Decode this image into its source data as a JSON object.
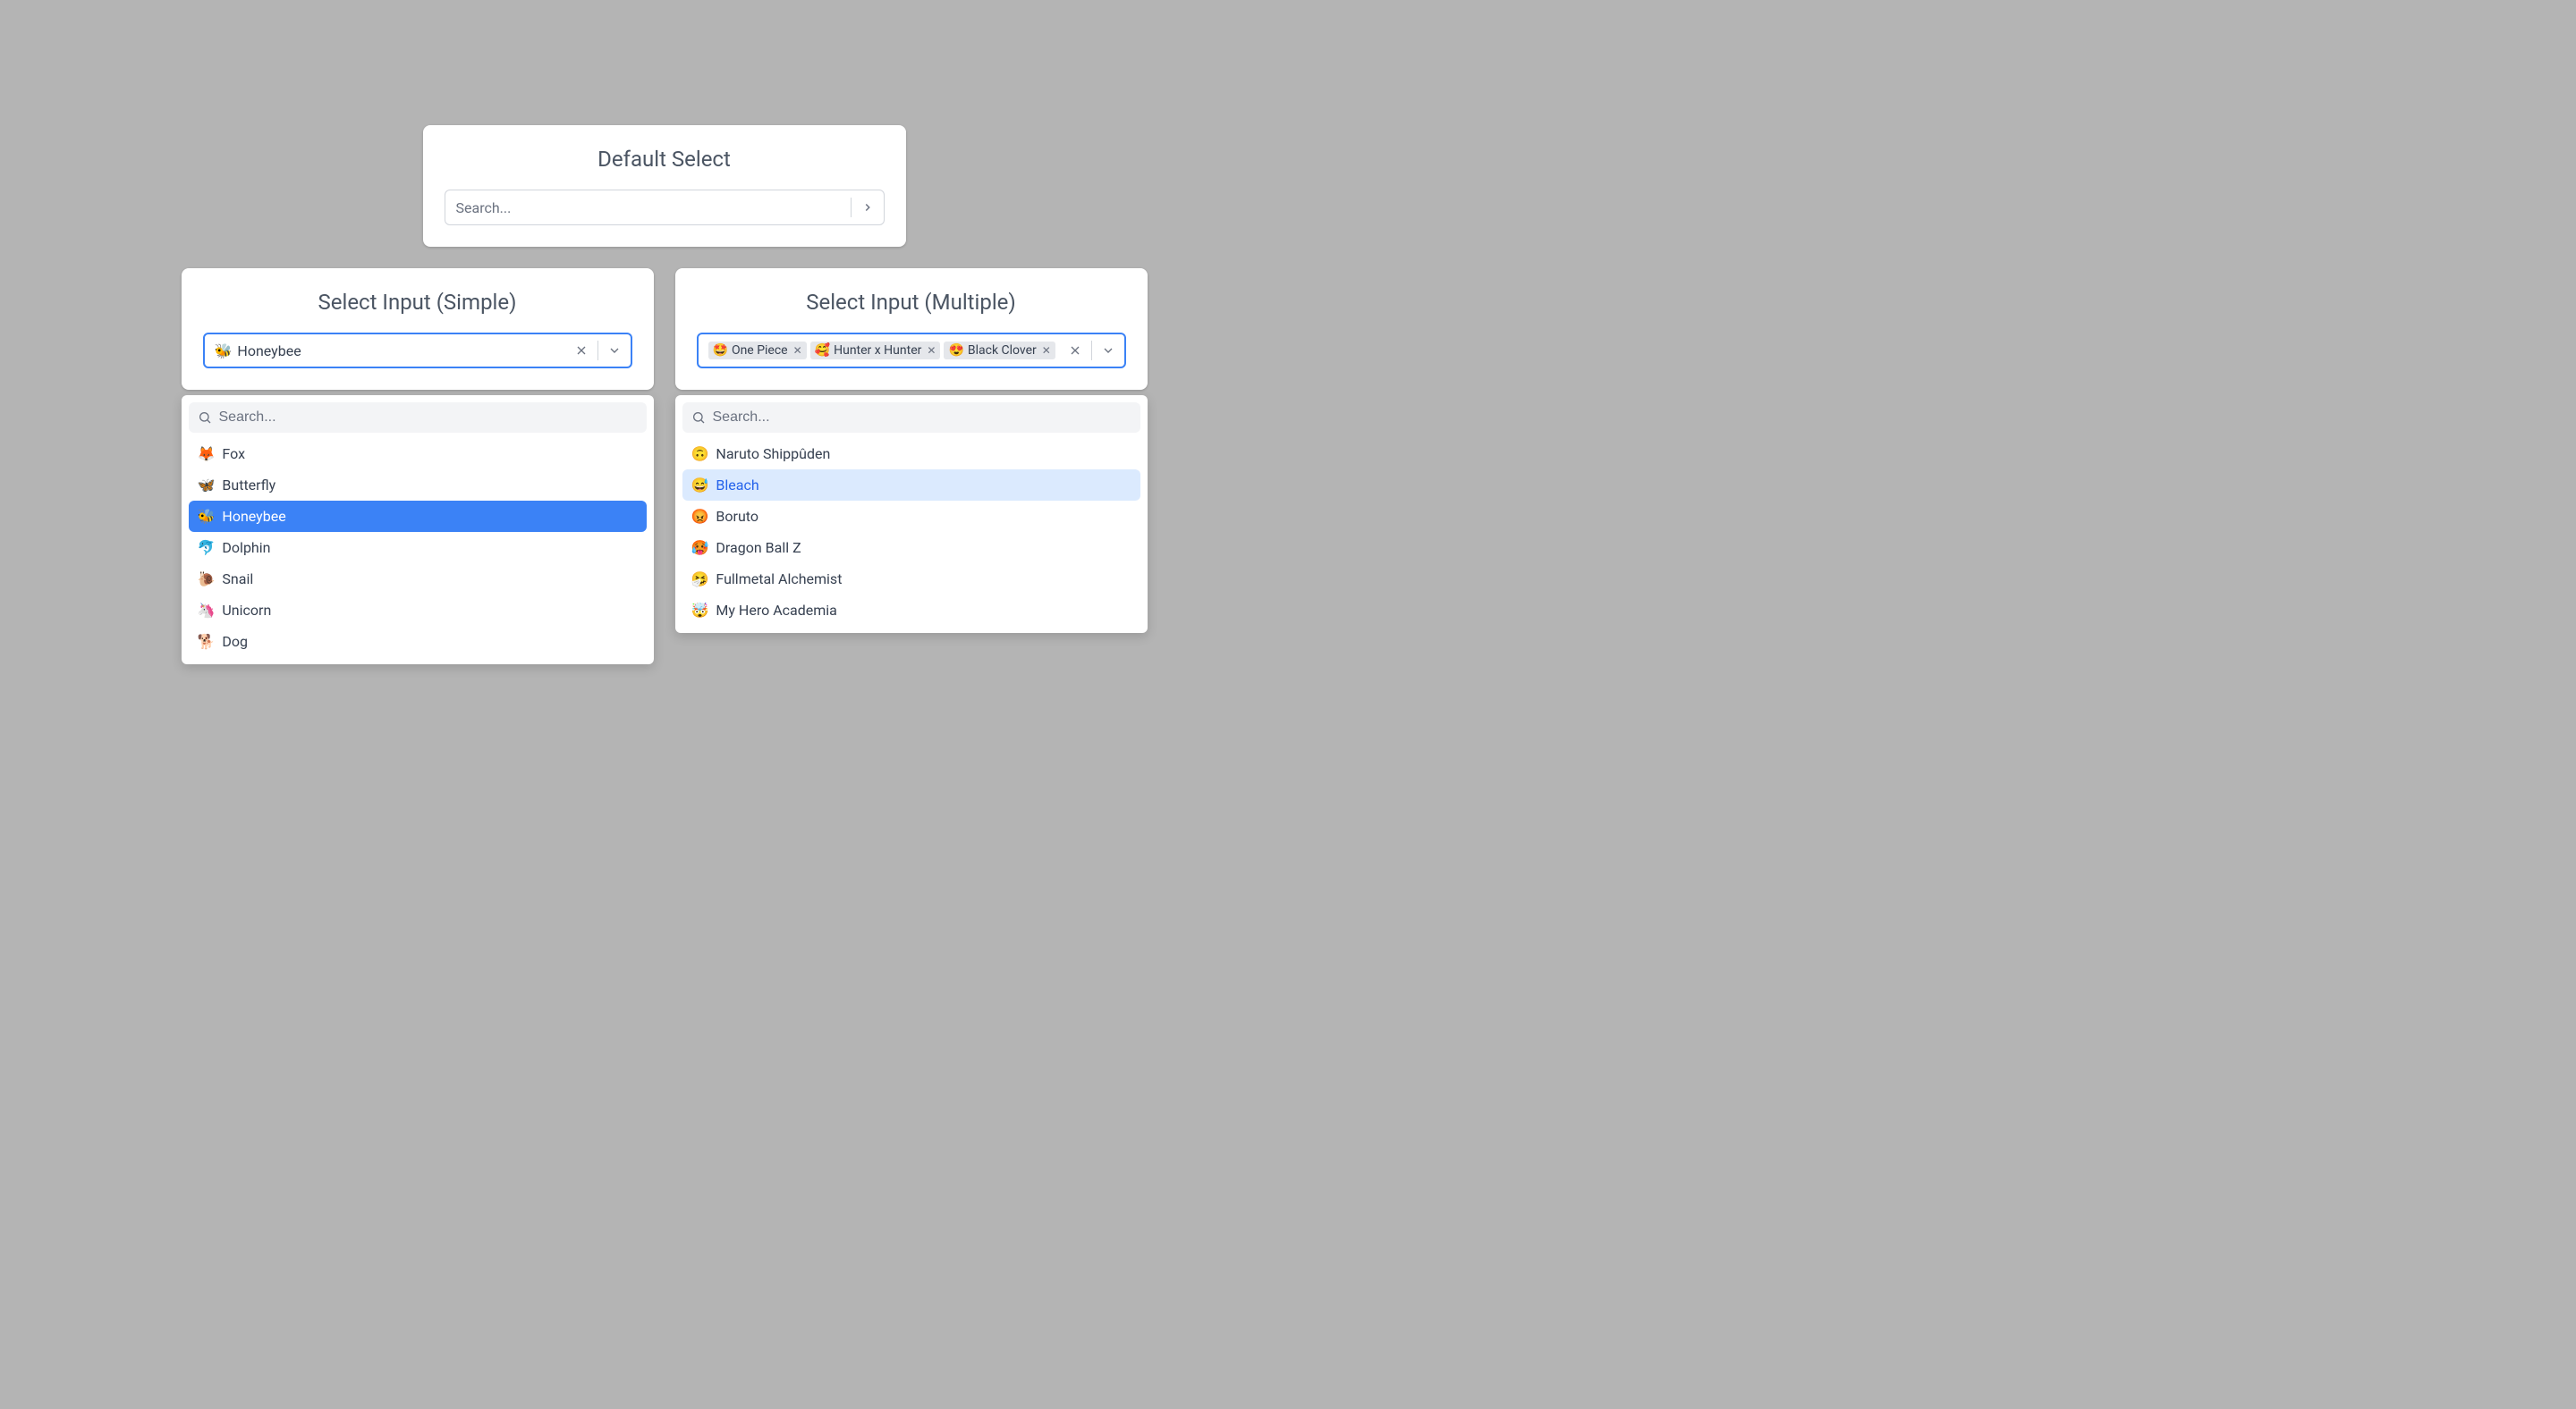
{
  "default_select": {
    "title": "Default Select",
    "placeholder": "Search..."
  },
  "simple_select": {
    "title": "Select Input (Simple)",
    "selected": {
      "emoji": "🐝",
      "label": "Honeybee"
    },
    "search_placeholder": "Search...",
    "options": [
      {
        "emoji": "🦊",
        "label": "Fox",
        "state": ""
      },
      {
        "emoji": "🦋",
        "label": "Butterfly",
        "state": ""
      },
      {
        "emoji": "🐝",
        "label": "Honeybee",
        "state": "selected"
      },
      {
        "emoji": "🐬",
        "label": "Dolphin",
        "state": ""
      },
      {
        "emoji": "🐌",
        "label": "Snail",
        "state": ""
      },
      {
        "emoji": "🦄",
        "label": "Unicorn",
        "state": ""
      },
      {
        "emoji": "🐕",
        "label": "Dog",
        "state": ""
      }
    ]
  },
  "multiple_select": {
    "title": "Select Input (Multiple)",
    "search_placeholder": "Search...",
    "tags": [
      {
        "emoji": "🤩",
        "label": "One Piece"
      },
      {
        "emoji": "🥰",
        "label": "Hunter x Hunter"
      },
      {
        "emoji": "😍",
        "label": "Black Clover"
      }
    ],
    "options": [
      {
        "emoji": "🙃",
        "label": "Naruto Shippûden",
        "state": ""
      },
      {
        "emoji": "😅",
        "label": "Bleach",
        "state": "hover"
      },
      {
        "emoji": "😡",
        "label": "Boruto",
        "state": ""
      },
      {
        "emoji": "🥵",
        "label": "Dragon Ball Z",
        "state": ""
      },
      {
        "emoji": "🤧",
        "label": "Fullmetal Alchemist",
        "state": ""
      },
      {
        "emoji": "🤯",
        "label": "My Hero Academia",
        "state": ""
      }
    ]
  }
}
